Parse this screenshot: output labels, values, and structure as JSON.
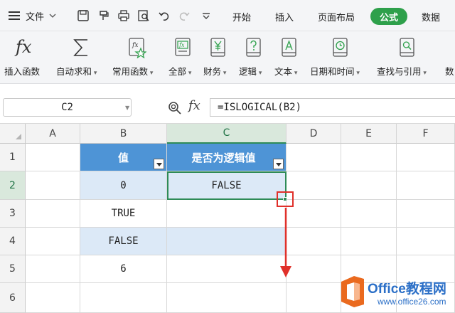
{
  "menubar": {
    "file_label": "文件",
    "tabs": [
      {
        "label": "开始",
        "active": false
      },
      {
        "label": "插入",
        "active": false
      },
      {
        "label": "页面布局",
        "active": false
      },
      {
        "label": "公式",
        "active": true
      },
      {
        "label": "数据",
        "active": false
      }
    ],
    "accent_color": "#2ea04b"
  },
  "ribbon": {
    "buttons": [
      {
        "label": "插入函数",
        "icon": "function-fx-icon"
      },
      {
        "label": "自动求和",
        "icon": "sigma-sum-icon",
        "dropdown": true
      },
      {
        "label": "常用函数",
        "icon": "star-fx-icon",
        "dropdown": true
      },
      {
        "label": "全部",
        "icon": "fx-box-icon",
        "dropdown": true
      },
      {
        "label": "财务",
        "icon": "yen-book-icon",
        "dropdown": true
      },
      {
        "label": "逻辑",
        "icon": "question-book-icon",
        "dropdown": true
      },
      {
        "label": "文本",
        "icon": "letter-a-book-icon",
        "dropdown": true
      },
      {
        "label": "日期和时间",
        "icon": "clock-book-icon",
        "dropdown": true
      },
      {
        "label": "查找与引用",
        "icon": "search-book-icon",
        "dropdown": true
      },
      {
        "label": "数",
        "icon": ""
      }
    ]
  },
  "formula_bar": {
    "cell_ref": "C2",
    "fx_label": "fx",
    "formula": "=ISLOGICAL(B2)"
  },
  "grid": {
    "columns": [
      "A",
      "B",
      "C",
      "D",
      "E",
      "F"
    ],
    "rows": [
      "1",
      "2",
      "3",
      "4",
      "5",
      "6"
    ],
    "selected_column": "C",
    "selected_row": "2",
    "header_row": [
      "值",
      "是否为逻辑值"
    ],
    "data": [
      [
        "0",
        "FALSE"
      ],
      [
        "TRUE",
        ""
      ],
      [
        "FALSE",
        ""
      ],
      [
        "6",
        ""
      ]
    ],
    "header_color": "#4e94d6",
    "band_color": "#dce9f7"
  },
  "watermark": {
    "name": "Office教程网",
    "url": "www.office26.com"
  }
}
